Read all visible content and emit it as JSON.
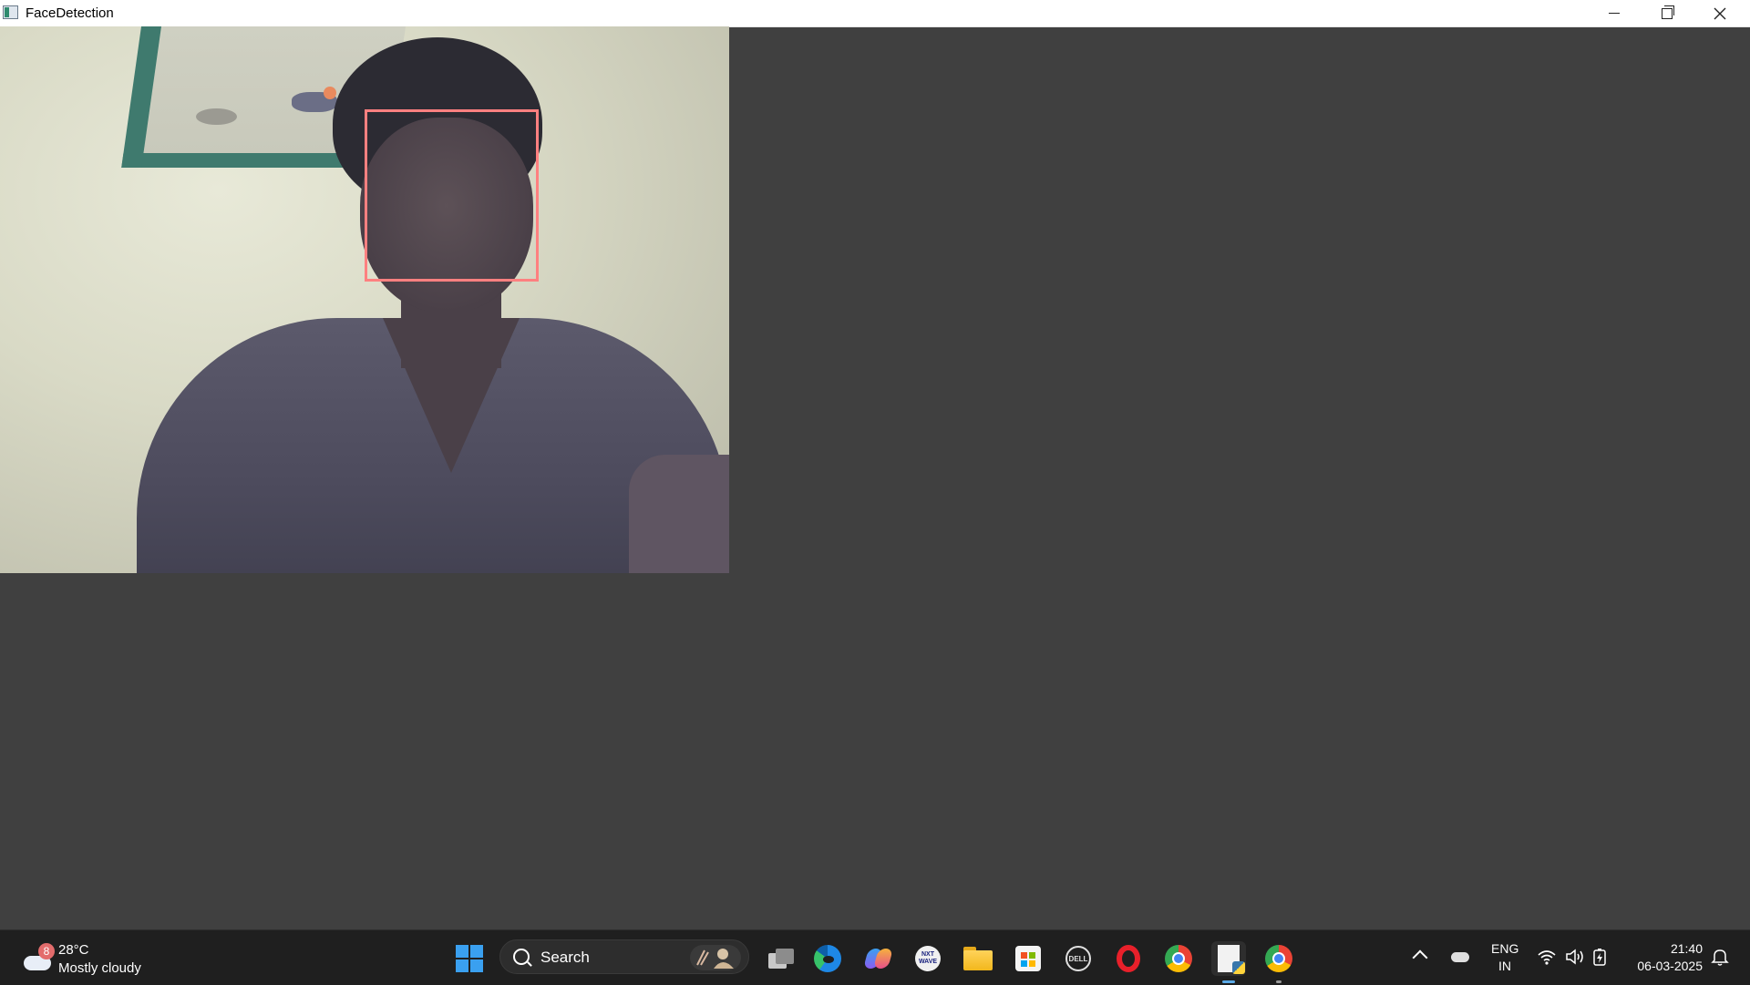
{
  "window": {
    "title": "FaceDetection",
    "controls": {
      "minimize": "minimize",
      "maximize": "restore",
      "close": "close"
    }
  },
  "camera": {
    "face_box_color": "#ff8080"
  },
  "taskbar": {
    "weather": {
      "badge": "8",
      "temperature": "28°C",
      "condition": "Mostly cloudy"
    },
    "search": {
      "label": "Search"
    },
    "apps": [
      {
        "name": "start-icon"
      },
      {
        "name": "task-view-icon"
      },
      {
        "name": "edge-icon"
      },
      {
        "name": "copilot-icon"
      },
      {
        "name": "nxtwave-icon",
        "text": "NXT WAVE"
      },
      {
        "name": "file-explorer-icon"
      },
      {
        "name": "microsoft-store-icon"
      },
      {
        "name": "dell-icon",
        "text": "DELL"
      },
      {
        "name": "opera-icon"
      },
      {
        "name": "chrome-icon"
      },
      {
        "name": "python-app-icon"
      },
      {
        "name": "chrome-profile-icon"
      }
    ],
    "tray": {
      "language_line1": "ENG",
      "language_line2": "IN",
      "time": "21:40",
      "date": "06-03-2025"
    },
    "accent_color": "#5aa9e6"
  }
}
